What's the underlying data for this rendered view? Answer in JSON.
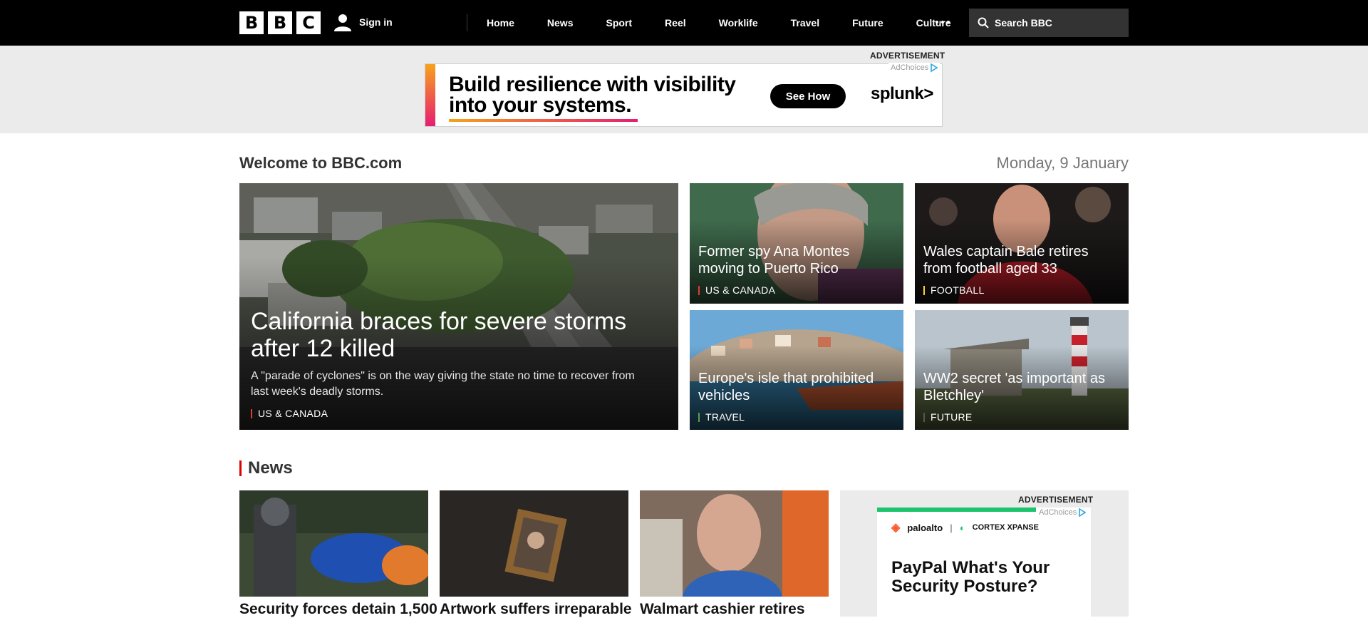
{
  "header": {
    "logo_letters": [
      "B",
      "B",
      "C"
    ],
    "signin_label": "Sign in",
    "nav": [
      "Home",
      "News",
      "Sport",
      "Reel",
      "Worklife",
      "Travel",
      "Future",
      "Culture"
    ],
    "search_placeholder": "Search BBC"
  },
  "top_ad": {
    "label": "ADVERTISEMENT",
    "adchoices": "AdChoices",
    "headline_line1": "Build resilience with visibility",
    "headline_line2": "into your systems.",
    "cta": "See How",
    "brand": "splunk>"
  },
  "welcome": {
    "title": "Welcome to BBC.com",
    "date": "Monday, 9 January"
  },
  "hero": {
    "title": "California braces for severe storms after 12 killed",
    "summary": "A \"parade of cyclones\" is on the way giving the state no time to recover from last week's deadly storms.",
    "tag": "US & CANADA"
  },
  "cards": [
    {
      "title": "Former spy Ana Montes moving to Puerto Rico",
      "tag": "US & CANADA",
      "tag_color": "#e03c31"
    },
    {
      "title": "Wales captain Bale retires from football aged 33",
      "tag": "FOOTBALL",
      "tag_color": "#ffd230"
    },
    {
      "title": "Europe's isle that prohibited vehicles",
      "tag": "TRAVEL",
      "tag_color": "#589e50"
    },
    {
      "title": "WW2 secret 'as important as Bletchley'",
      "tag": "FUTURE",
      "tag_color": "#555555"
    }
  ],
  "news": {
    "heading": "News",
    "items": [
      {
        "title": "Security forces detain 1,500"
      },
      {
        "title": "Artwork suffers irreparable"
      },
      {
        "title": "Walmart cashier retires"
      }
    ]
  },
  "side_ad": {
    "label": "ADVERTISEMENT",
    "adchoices": "AdChoices",
    "brand1": "paloalto",
    "brand2": "CORTEX XPANSE",
    "copy_line1": "PayPal What's Your",
    "copy_line2": "Security Posture?"
  },
  "colors": {
    "header_bg": "#000000",
    "ad_band_bg": "#ebebeb",
    "news_accent": "#dd0000"
  }
}
